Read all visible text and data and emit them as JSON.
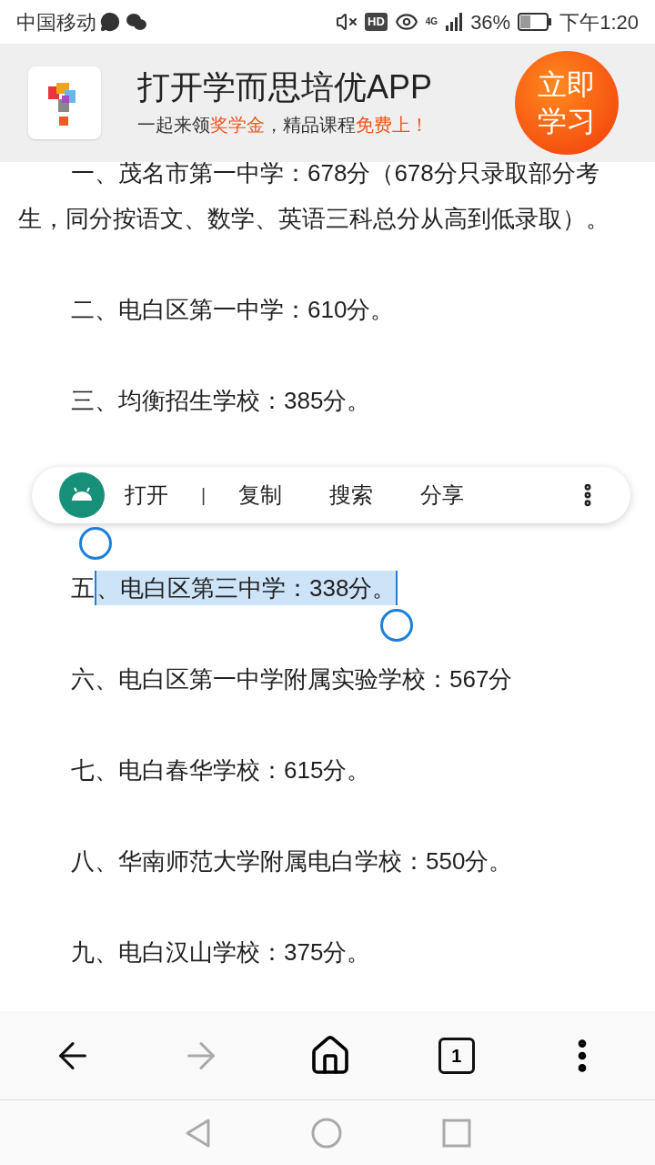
{
  "status_bar": {
    "carrier": "中国移动",
    "network": "4G",
    "hd": "HD",
    "battery": "36%",
    "time": "下午1:20"
  },
  "banner": {
    "title": "打开学而思培优APP",
    "subtitle": [
      {
        "text": "一起来领",
        "highlight": false
      },
      {
        "text": "奖学金",
        "highlight": true
      },
      {
        "text": "，精品课程",
        "highlight": false
      },
      {
        "text": "免费上！",
        "highlight": true
      }
    ],
    "button": "立即学习"
  },
  "paragraphs": [
    [
      {
        "text": "一、茂名市第一中学：678分（678分只录取部分考生，同分按语文、数学、英语三科总分从高到低录取）。",
        "selected": false
      }
    ],
    [
      {
        "text": "二、电白区第一中学：610分。",
        "selected": false
      }
    ],
    [
      {
        "text": "三、均衡招生学校：385分。",
        "selected": false
      }
    ],
    [
      {
        "text": "五",
        "selected": false
      },
      {
        "text": "、电白区第三中学：338分。",
        "selected": true
      }
    ],
    [
      {
        "text": "六、电白区第一中学附属实验学校：567分",
        "selected": false
      }
    ],
    [
      {
        "text": "七、电白春华学校：615分。",
        "selected": false
      }
    ],
    [
      {
        "text": "八、华南师范大学附属电白学校：550分。",
        "selected": false
      }
    ],
    [
      {
        "text": "九、电白汉山学校：375分。",
        "selected": false
      }
    ]
  ],
  "selection_menu": {
    "items": [
      {
        "label": "打开",
        "kind": "action"
      },
      {
        "label": "|",
        "kind": "separator"
      },
      {
        "label": "复制",
        "kind": "action"
      },
      {
        "label": "搜索",
        "kind": "action"
      },
      {
        "label": "分享",
        "kind": "action"
      }
    ]
  },
  "toolbar": {
    "back_disabled": false,
    "forward_disabled": true,
    "tab_count": "1"
  }
}
